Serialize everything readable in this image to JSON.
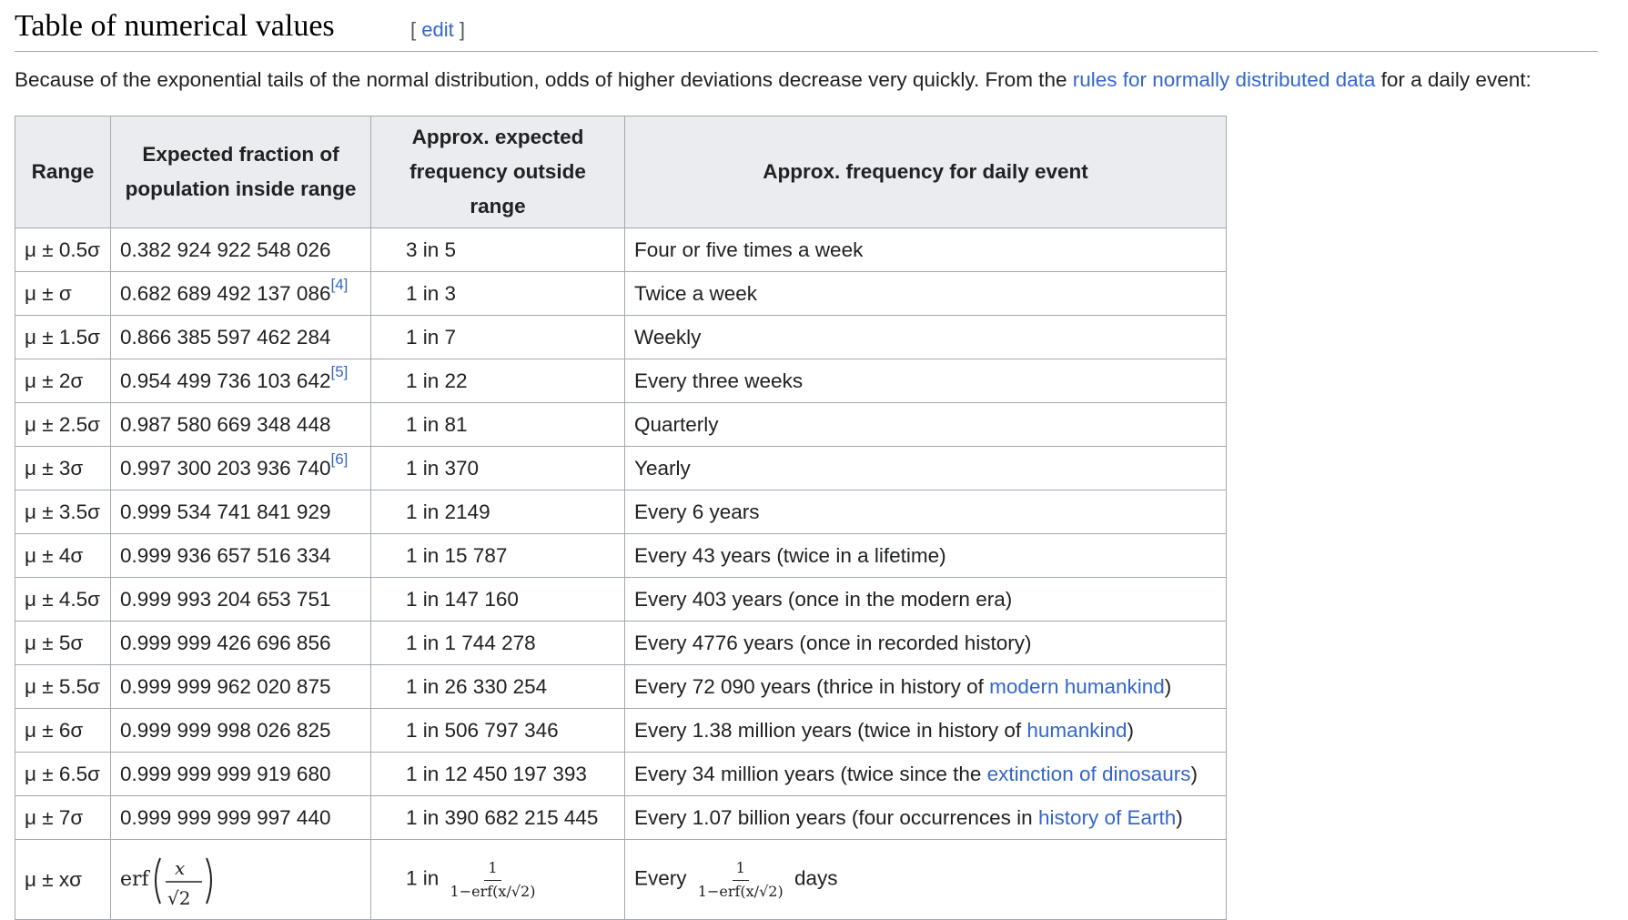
{
  "section": {
    "title": "Table of numerical values",
    "edit_open": "[ ",
    "edit_label": "edit",
    "edit_close": " ]"
  },
  "intro": {
    "text_before": "Because of the exponential tails of the normal distribution, odds of higher deviations decrease very quickly. From the ",
    "link": "rules for normally distributed data",
    "text_after": " for a daily event:"
  },
  "table": {
    "headers": {
      "range": "Range",
      "fraction_line1": "Expected fraction of",
      "fraction_line2": "population inside range",
      "freq_line1": "Approx. expected",
      "freq_line2": "frequency outside range",
      "daily": "Approx. frequency for daily event"
    },
    "rows": [
      {
        "range": "μ ± 0.5σ",
        "fraction": "0.382 924 922 548 026",
        "ref": "",
        "freq": "3 in 5",
        "daily": "Four or five times a week",
        "link": "",
        "after": ""
      },
      {
        "range": "μ ± σ",
        "fraction": "0.682 689 492 137 086",
        "ref": "[4]",
        "freq": "1 in 3",
        "daily": "Twice a week",
        "link": "",
        "after": ""
      },
      {
        "range": "μ ± 1.5σ",
        "fraction": "0.866 385 597 462 284",
        "ref": "",
        "freq": "1 in 7",
        "daily": "Weekly",
        "link": "",
        "after": ""
      },
      {
        "range": "μ ± 2σ",
        "fraction": "0.954 499 736 103 642",
        "ref": "[5]",
        "freq": "1 in 22",
        "daily": "Every three weeks",
        "link": "",
        "after": ""
      },
      {
        "range": "μ ± 2.5σ",
        "fraction": "0.987 580 669 348 448",
        "ref": "",
        "freq": "1 in 81",
        "daily": "Quarterly",
        "link": "",
        "after": ""
      },
      {
        "range": "μ ± 3σ",
        "fraction": "0.997 300 203 936 740",
        "ref": "[6]",
        "freq": "1 in 370",
        "daily": "Yearly",
        "link": "",
        "after": ""
      },
      {
        "range": "μ ± 3.5σ",
        "fraction": "0.999 534 741 841 929",
        "ref": "",
        "freq": "1 in 2149",
        "daily": "Every 6 years",
        "link": "",
        "after": ""
      },
      {
        "range": "μ ± 4σ",
        "fraction": "0.999 936 657 516 334",
        "ref": "",
        "freq": "1 in 15 787",
        "daily": "Every 43 years (twice in a lifetime)",
        "link": "",
        "after": ""
      },
      {
        "range": "μ ± 4.5σ",
        "fraction": "0.999 993 204 653 751",
        "ref": "",
        "freq": "1 in 147 160",
        "daily": "Every 403 years (once in the modern era)",
        "link": "",
        "after": ""
      },
      {
        "range": "μ ± 5σ",
        "fraction": "0.999 999 426 696 856",
        "ref": "",
        "freq": "1 in 1 744 278",
        "daily": "Every 4776 years (once in recorded history)",
        "link": "",
        "after": ""
      },
      {
        "range": "μ ± 5.5σ",
        "fraction": "0.999 999 962 020 875",
        "ref": "",
        "freq": "1 in 26 330 254",
        "daily": "Every 72 090 years (thrice in history of ",
        "link": "modern humankind",
        "after": ")"
      },
      {
        "range": "μ ± 6σ",
        "fraction": "0.999 999 998 026 825",
        "ref": "",
        "freq": "1 in 506 797 346",
        "daily": "Every 1.38 million years (twice in history of ",
        "link": "humankind",
        "after": ")"
      },
      {
        "range": "μ ± 6.5σ",
        "fraction": "0.999 999 999 919 680",
        "ref": "",
        "freq": "1 in 12 450 197 393",
        "daily": "Every 34 million years (twice since the ",
        "link": "extinction of dinosaurs",
        "after": ")"
      },
      {
        "range": "μ ± 7σ",
        "fraction": "0.999 999 999 997 440",
        "ref": "",
        "freq": "1 in 390 682 215 445",
        "daily": "Every 1.07 billion years (four occurrences in ",
        "link": "history of Earth",
        "after": ")"
      }
    ],
    "general": {
      "range": "μ ± xσ",
      "fraction_formula": "erf(x/√2)",
      "freq_prefix": "1 in",
      "freq_num": "1",
      "freq_den": "1−erf(x/√2)",
      "daily_prefix": "Every",
      "daily_num": "1",
      "daily_den": "1−erf(x/√2)",
      "daily_suffix": "days"
    }
  }
}
